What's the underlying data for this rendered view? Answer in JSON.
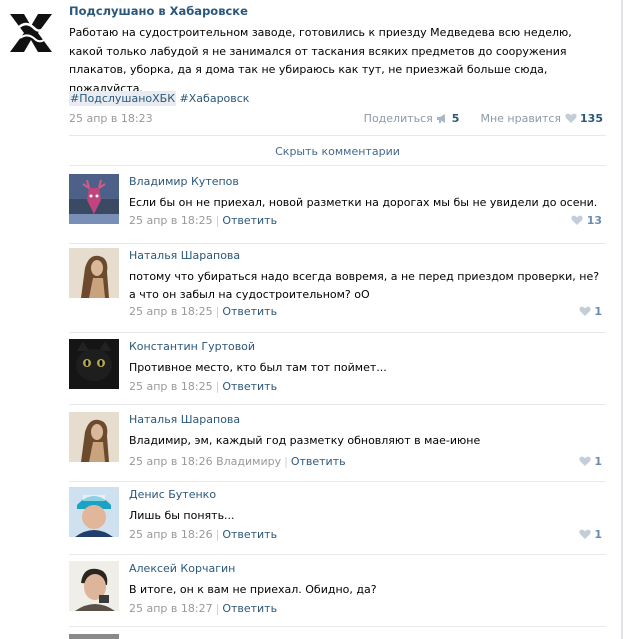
{
  "post": {
    "title": "Подслушано в Хабаровске",
    "text": "Работаю на судостроительном заводе, готовились к приезду Медведева всю неделю, какой только лабудой я не занимался от таскания всяких предметов до сооружения плакатов, уборка, да я дома так не убираюсь как тут, не приезжай больше сюда, пожалуйста.",
    "hashtags": [
      "#ПодслушаноХБК",
      "#Хабаровск"
    ],
    "date": "25 апр в 18:23",
    "share_label": "Поделиться",
    "share_count": "5",
    "like_label": "Мне нравится",
    "like_count": "135",
    "avatar_icon": "community-logo-icon"
  },
  "hide_comments_label": "Скрыть комментарии",
  "comments": [
    {
      "author": "Владимир Кутепов",
      "lines": [
        "Если бы он не приехал, новой разметки на дорогах мы бы не увидели до осени."
      ],
      "date": "25 апр в 18:25",
      "reply_to": "",
      "reply_label": "Ответить",
      "likes": "13",
      "avatar_icon": "deer-avatar-icon"
    },
    {
      "author": "Наталья Шарапова",
      "lines": [
        "потому что убираться надо всегда вовремя, а не перед приездом проверки, не?",
        "а что он забыл на судостроительном? оО"
      ],
      "date": "25 апр в 18:25",
      "reply_to": "",
      "reply_label": "Ответить",
      "likes": "1",
      "avatar_icon": "woman-avatar-icon"
    },
    {
      "author": "Константин Гуртовой",
      "lines": [
        "Противное место, кто был там тот поймет..."
      ],
      "date": "25 апр в 18:25",
      "reply_to": "",
      "reply_label": "Ответить",
      "likes": "",
      "avatar_icon": "black-cat-avatar-icon"
    },
    {
      "author": "Наталья Шарапова",
      "lines": [
        "Владимир, эм, каждый год разметку обновляют в мае-июне"
      ],
      "date": "25 апр в 18:26",
      "reply_to": "Владимиру",
      "reply_label": "Ответить",
      "likes": "1",
      "avatar_icon": "woman-avatar-icon"
    },
    {
      "author": "Денис Бутенко",
      "lines": [
        "Лишь бы понять..."
      ],
      "date": "25 апр в 18:26",
      "reply_to": "",
      "reply_label": "Ответить",
      "likes": "1",
      "avatar_icon": "man-in-cap-avatar-icon"
    },
    {
      "author": "Алексей Корчагин",
      "lines": [
        "В итоге, он к вам не приехал. Обидно, да?"
      ],
      "date": "25 апр в 18:27",
      "reply_to": "",
      "reply_label": "Ответить",
      "likes": "",
      "avatar_icon": "man-avatar-icon"
    }
  ],
  "colors": {
    "link": "#2b587a",
    "meta": "#999999",
    "like": "#6a8bb0",
    "divider": "#e7eaed"
  }
}
